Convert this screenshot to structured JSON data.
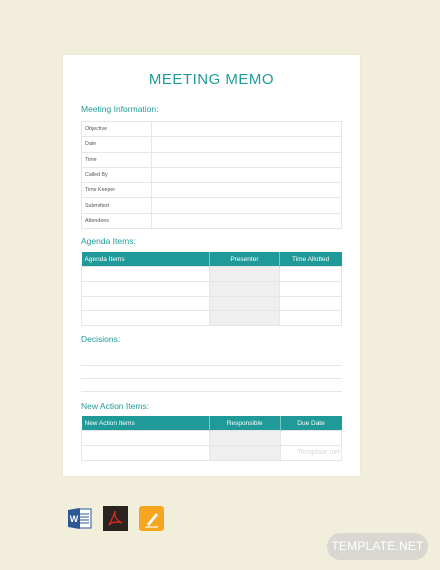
{
  "document": {
    "title": "MEETING MEMO",
    "meeting_information": {
      "heading": "Meeting Information:",
      "fields": [
        "Objective",
        "Date",
        "Time",
        "Called By",
        "Time Keeper",
        "Submitted",
        "Attendees"
      ]
    },
    "agenda": {
      "heading": "Agenda Items:",
      "columns": [
        "Agenda Items",
        "Presenter",
        "Time Allotted"
      ]
    },
    "decisions": {
      "heading": "Decisions:"
    },
    "action_items": {
      "heading": "New Action Items:",
      "columns": [
        "New Action Items",
        "Responsible",
        "Due Date"
      ]
    },
    "watermark": "Template.net"
  },
  "format_icons": [
    "word-icon",
    "pdf-icon",
    "pages-icon"
  ],
  "brand_badge": "TEMPLATE.NET",
  "colors": {
    "accent": "#1f9a98",
    "background": "#f1eedb",
    "shade": "#efefef"
  }
}
